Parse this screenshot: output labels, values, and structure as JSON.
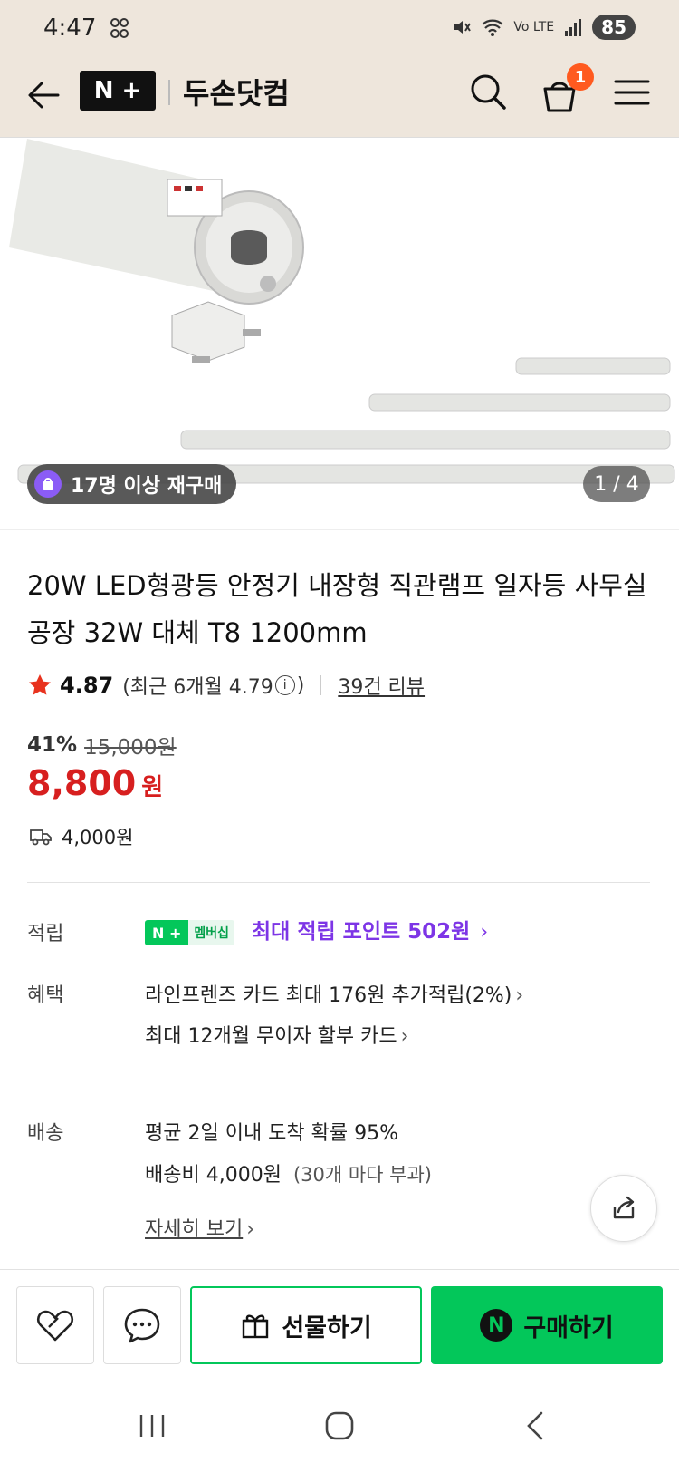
{
  "status_bar": {
    "time": "4:47",
    "battery": "85",
    "network": "Vo LTE"
  },
  "header": {
    "logo_text": "N +",
    "brand": "두손닷컴",
    "cart_count": "1"
  },
  "gallery": {
    "rebuy_badge": "17명 이상 재구매",
    "page_indicator": "1 / 4"
  },
  "product": {
    "title_line1": "20W LED형광등 안정기 내장형 직관램프 일자등 사무실",
    "title_line2": "공장 32W 대체 T8 1200mm",
    "rating": "4.87",
    "recent_rating_prefix": "(최근 6개월 4.79",
    "recent_rating_suffix": ")",
    "review_count": "39건 리뷰",
    "discount_rate": "41%",
    "original_price": "15,000원",
    "sale_price": "8,800",
    "sale_currency": "원",
    "shipping_fee": "4,000원"
  },
  "points": {
    "label": "적립",
    "badge_np": "N +",
    "badge_member": "멤버십",
    "text": "최대 적립 포인트 502원"
  },
  "benefits": {
    "label": "혜택",
    "line1": "라인프렌즈 카드 최대 176원 추가적립(2%)",
    "line2": "최대 12개월 무이자 할부 카드"
  },
  "delivery": {
    "label": "배송",
    "line1": "평균 2일 이내 도착 확률 95%",
    "line2_main": "배송비 4,000원",
    "line2_note": "(30개 마다 부과)",
    "detail_link": "자세히 보기"
  },
  "actions": {
    "gift": "선물하기",
    "buy": "구매하기",
    "npay_letter": "N"
  },
  "colors": {
    "accent_green": "#03c75a",
    "price_red": "#d71f1f",
    "points_purple": "#7d35e6",
    "header_bg": "#eee6dc"
  }
}
